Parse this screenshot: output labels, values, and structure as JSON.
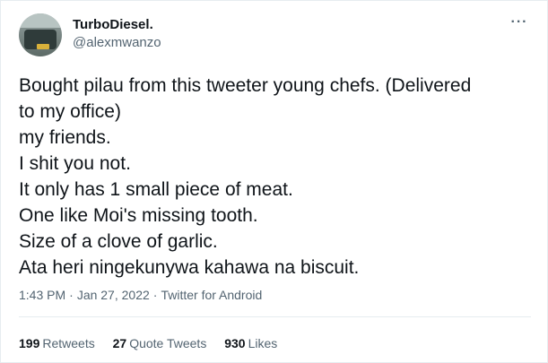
{
  "author": {
    "display_name": "TurboDiesel.",
    "handle": "@alexmwanzo",
    "avatar_icon": "profile-avatar"
  },
  "menu": {
    "more_label": "···",
    "more_icon": "more-horizontal-icon"
  },
  "tweet": {
    "lines": [
      "Bought pilau from this tweeter young chefs. (Delivered",
      "to my office)",
      "my friends.",
      "I shit you not.",
      "It only has 1 small piece of meat.",
      "One like Moi's missing tooth.",
      "Size of a clove of garlic.",
      "Ata heri ningekunywa kahawa na biscuit."
    ]
  },
  "meta": {
    "time": "1:43 PM",
    "separator": "·",
    "date": "Jan 27, 2022",
    "source": "Twitter for Android"
  },
  "stats": {
    "retweets_count": "199",
    "retweets_label": "Retweets",
    "quotes_count": "27",
    "quotes_label": "Quote Tweets",
    "likes_count": "930",
    "likes_label": "Likes"
  },
  "colors": {
    "text": "#0f1419",
    "secondary": "#536471",
    "border": "#e6ecf0"
  }
}
